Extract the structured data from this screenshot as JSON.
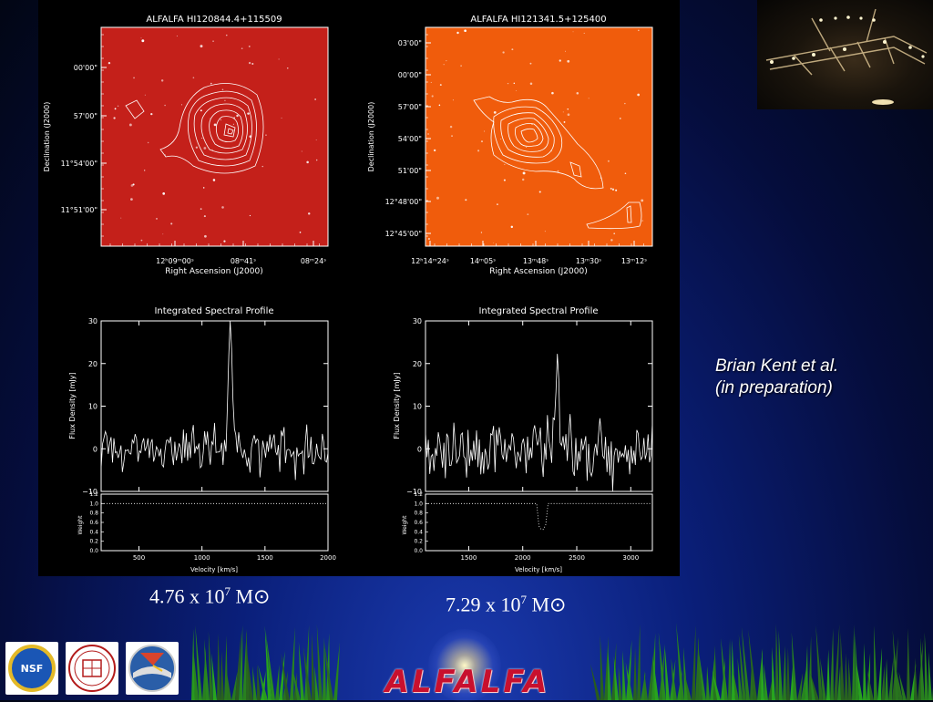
{
  "panels": {
    "left_image": {
      "title": "ALFALFA HI120844.4+115509",
      "xlabel": "Right Ascension (J2000)",
      "ylabel": "Declination (J2000)",
      "xticks": [
        "12ʰ09ᵐ00ˢ",
        "08ᵐ41ˢ",
        "08ᵐ24ˢ"
      ],
      "yticks": [
        "00'00\"",
        "57'00\"",
        "11°54'00\"",
        "11°51'00\""
      ],
      "background_color": "#c4201a"
    },
    "right_image": {
      "title": "ALFALFA HI121341.5+125400",
      "xlabel": "Right Ascension (J2000)",
      "ylabel": "Declination (J2000)",
      "xticks": [
        "12ʰ14ᵐ24ˢ",
        "14ᵐ05ˢ",
        "13ᵐ48ˢ",
        "13ᵐ30ˢ",
        "13ᵐ12ˢ"
      ],
      "yticks": [
        "03'00\"",
        "00'00\"",
        "57'00\"",
        "54'00\"",
        "51'00\"",
        "12°48'00\"",
        "12°45'00\""
      ],
      "background_color": "#f05c0c"
    }
  },
  "chart_data": [
    {
      "type": "line",
      "title": "Integrated Spectral Profile",
      "xlabel": "Velocity [km/s]",
      "ylabel": "Flux Density [mJy]",
      "weight_label": "Weight",
      "xlim": [
        200,
        2000
      ],
      "ylim": [
        -10,
        30
      ],
      "xticks": [
        500,
        1000,
        1500,
        2000
      ],
      "yticks": [
        -10,
        0,
        10,
        20,
        30
      ],
      "weight_ticks": [
        "0.0",
        "0.2",
        "0.4",
        "0.6",
        "0.8",
        "1.0",
        "1.2"
      ],
      "peak": {
        "x": 1225,
        "y": 26.5
      },
      "baseline_rms": 2.5,
      "weight_level": 1.0
    },
    {
      "type": "line",
      "title": "Integrated Spectral Profile",
      "xlabel": "Velocity [km/s]",
      "ylabel": "Flux Density [mJy]",
      "weight_label": "Weight",
      "xlim": [
        1100,
        3200
      ],
      "ylim": [
        -10,
        30
      ],
      "xticks": [
        1500,
        2000,
        2500,
        3000
      ],
      "yticks": [
        -10,
        0,
        10,
        20,
        30
      ],
      "weight_ticks": [
        "0.0",
        "0.2",
        "0.4",
        "0.6",
        "0.8",
        "1.0",
        "1.2"
      ],
      "peak": {
        "x": 2320,
        "y": 21.5
      },
      "baseline_rms": 3.5,
      "weight_level": 1.0,
      "weight_dip": {
        "x_from": 2130,
        "x_to": 2230,
        "level": 0.45
      }
    }
  ],
  "masses": {
    "left": {
      "mantissa": "4.76 x 10",
      "exponent": "7",
      "unit": "M⊙"
    },
    "right": {
      "mantissa": "7.29 x 10",
      "exponent": "7",
      "unit": "M⊙"
    }
  },
  "credit": {
    "line1": "Brian Kent et al.",
    "line2": "(in preparation)"
  },
  "footer": {
    "logo_text": "ALFALFA",
    "nsf_label": "NSF"
  },
  "colors": {
    "logo_red": "#c8102e",
    "grass": "#2e8a1e"
  }
}
